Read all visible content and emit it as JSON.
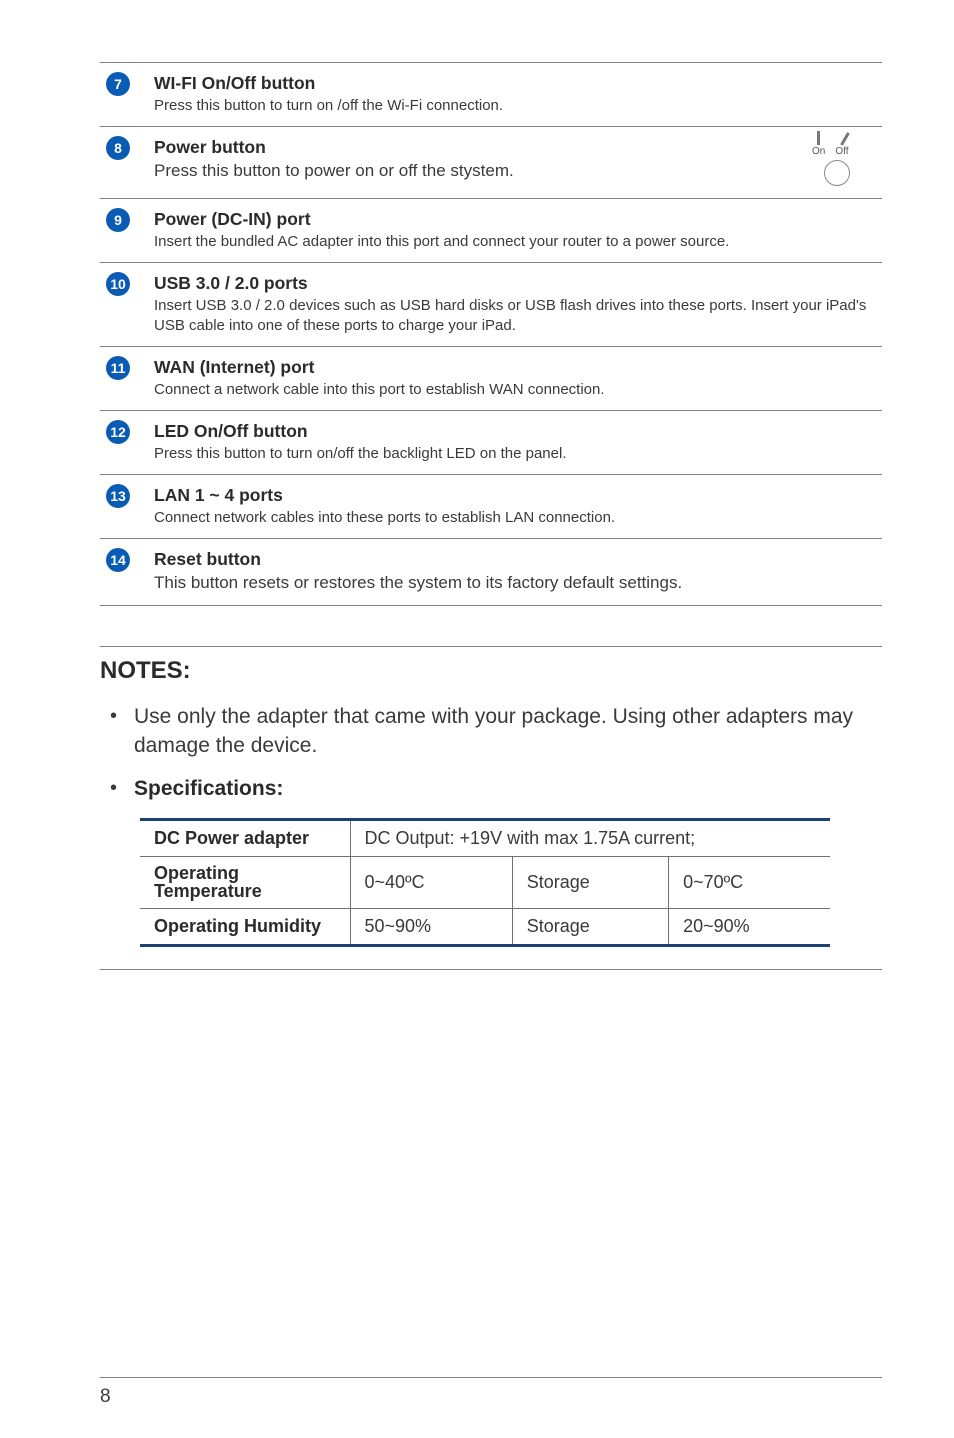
{
  "features": [
    {
      "num": "7",
      "title": "WI-FI On/Off button",
      "desc": "Press this button to turn on /off the Wi-Fi connection.",
      "descSize": "small"
    },
    {
      "num": "8",
      "title": "Power button",
      "desc": "Press this button to power on or off the stystem.",
      "descSize": "large",
      "hasSwitch": true,
      "switchOn": "On",
      "switchOff": "Off"
    },
    {
      "num": "9",
      "title": "Power (DC-IN) port",
      "desc": "Insert the bundled AC adapter into this port and connect your router to a power source.",
      "descSize": "small"
    },
    {
      "num": "10",
      "title": "USB 3.0 / 2.0 ports",
      "desc": "Insert USB 3.0 / 2.0 devices such as USB hard disks or USB flash drives into these ports. Insert your iPad's USB cable into one of these ports to charge your iPad.",
      "descSize": "small"
    },
    {
      "num": "11",
      "title": "WAN (Internet) port",
      "desc": "Connect a network cable into this port to establish WAN connection.",
      "descSize": "small"
    },
    {
      "num": "12",
      "title": "LED On/Off button",
      "desc": "Press this button to turn on/off the backlight LED on the panel.",
      "descSize": "small"
    },
    {
      "num": "13",
      "title": "LAN 1 ~ 4 ports",
      "desc": "Connect network cables into these ports to establish LAN connection.",
      "descSize": "small"
    },
    {
      "num": "14",
      "title": "Reset button",
      "desc": "This button resets or restores the system to its factory default settings.",
      "descSize": "large"
    }
  ],
  "notes": {
    "heading": "NOTES:",
    "items": [
      "Use only the adapter that came with your package. Using other adapters may damage the device.",
      "Specifications:"
    ]
  },
  "spec": {
    "rows": [
      {
        "h": "DC Power adapter",
        "c1": "DC Output: +19V with max 1.75A current;",
        "span": true
      },
      {
        "h1": "Operating",
        "h2": "Temperature",
        "c1": "0~40ºC",
        "c2": "Storage",
        "c3": "0~70ºC"
      },
      {
        "h": "Operating Humidity",
        "c1": "50~90%",
        "c2": "Storage",
        "c3": "20~90%"
      }
    ]
  },
  "pageNumber": "8"
}
